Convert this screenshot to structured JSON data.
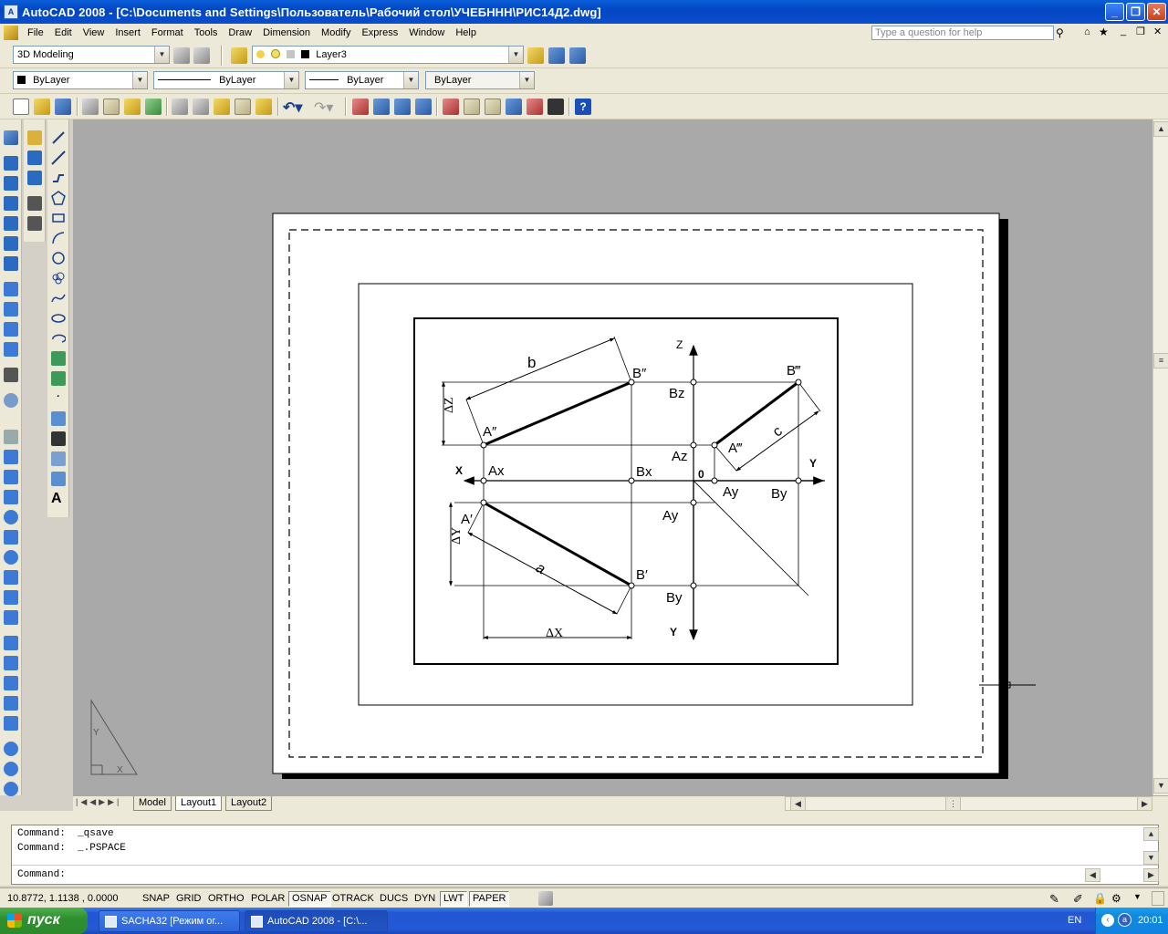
{
  "window": {
    "title": "AutoCAD 2008 - [C:\\Documents and Settings\\Пользователь\\Рабочий стол\\УЧЕБННН\\РИС14Д2.dwg]",
    "app_icon_label": "A"
  },
  "menu": {
    "items": [
      "File",
      "Edit",
      "View",
      "Insert",
      "Format",
      "Tools",
      "Draw",
      "Dimension",
      "Modify",
      "Express",
      "Window",
      "Help"
    ],
    "help_placeholder": "Type a question for help"
  },
  "toolbar": {
    "workspace": "3D Modeling",
    "layer": "Layer3",
    "color": "ByLayer",
    "linetype": "ByLayer",
    "lineweight": "ByLayer",
    "plotstyle": "ByLayer",
    "undo_icon": "undo-icon",
    "redo_icon": "redo-icon",
    "help_icon": "help-icon"
  },
  "drawing": {
    "labels": {
      "b": "b",
      "a": "a",
      "c": "c",
      "B2": "B″",
      "A2": "A″",
      "B3": "B‴",
      "A3": "A‴",
      "A1": "A′",
      "B1": "B′",
      "Bz": "Bz",
      "Az": "Az",
      "Ax": "Ax",
      "Bx": "Bx",
      "O": "0",
      "Ay_right": "Ay",
      "By_right": "By",
      "Ay_down": "Ay",
      "By_down": "By",
      "X": "X",
      "Y_right": "Y",
      "Z": "Z",
      "Y_down": "Y",
      "dZ": "ΔZ",
      "dY": "ΔY",
      "dX": "ΔX"
    }
  },
  "tabs": [
    "Model",
    "Layout1",
    "Layout2"
  ],
  "active_tab": "Layout1",
  "command": {
    "history": [
      "Command:  _qsave",
      "Command:  _.PSPACE"
    ],
    "prompt": "Command:"
  },
  "status": {
    "coords": "10.8772, 1.1138 , 0.0000",
    "toggles": [
      {
        "label": "SNAP",
        "on": false
      },
      {
        "label": "GRID",
        "on": false
      },
      {
        "label": "ORTHO",
        "on": false
      },
      {
        "label": "POLAR",
        "on": false
      },
      {
        "label": "OSNAP",
        "on": true
      },
      {
        "label": "OTRACK",
        "on": false
      },
      {
        "label": "DUCS",
        "on": false
      },
      {
        "label": "DYN",
        "on": false
      },
      {
        "label": "LWT",
        "on": true
      },
      {
        "label": "PAPER",
        "on": true
      }
    ]
  },
  "taskbar": {
    "start": "пуск",
    "tasks": [
      "SACHA32 [Режим ог...",
      "AutoCAD 2008 - [C:\\..."
    ],
    "lang": "EN",
    "time": "20:01"
  }
}
